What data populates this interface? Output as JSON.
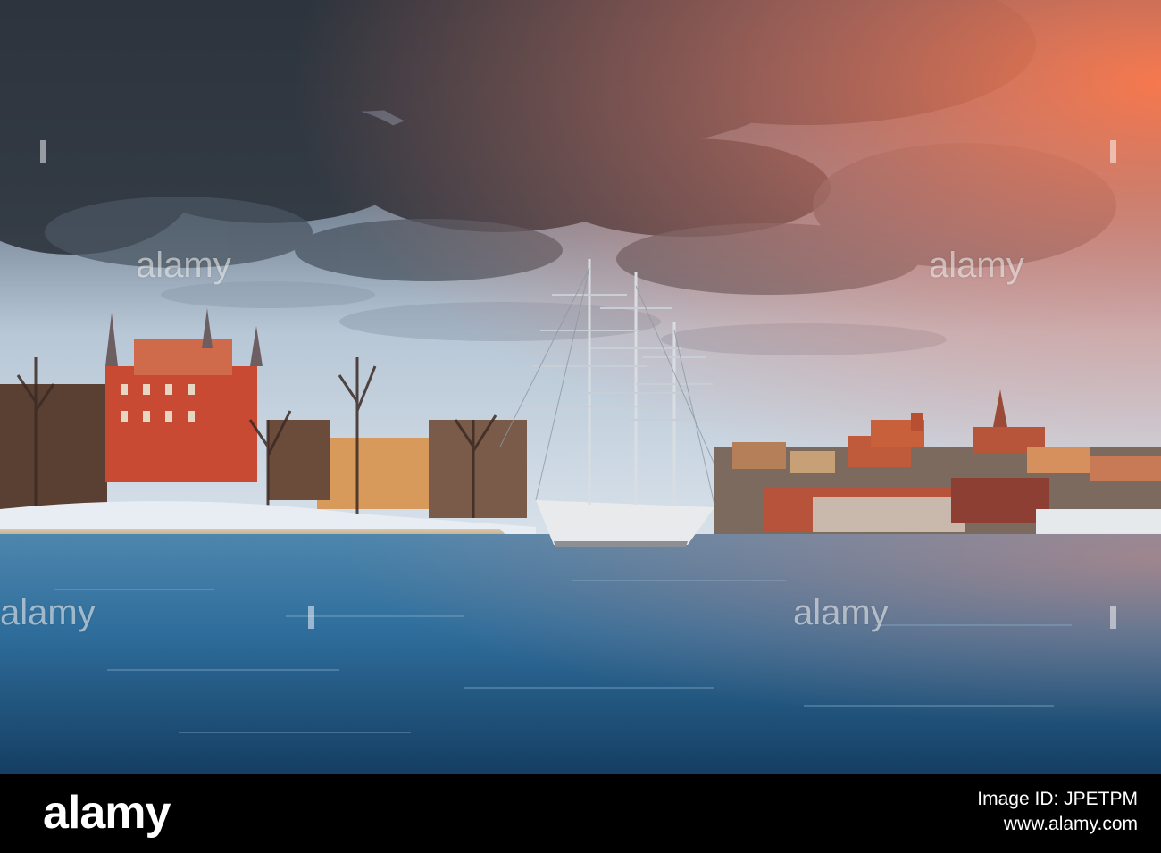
{
  "photo": {
    "description_icon": "harbor-photo",
    "colors": {
      "sky_dark": "#2b3440",
      "sky_light": "#c9d6e3",
      "sunset": "#ff6a4a",
      "water": "#2a6a96",
      "building_red": "#c9402a",
      "ship_hull": "#e9eaec"
    }
  },
  "watermarks": [
    "alamy",
    "alamy",
    "alamy",
    "alamy"
  ],
  "footer": {
    "logo": "alamy",
    "image_id_label": "Image ID: JPETPM",
    "url": "www.alamy.com"
  }
}
